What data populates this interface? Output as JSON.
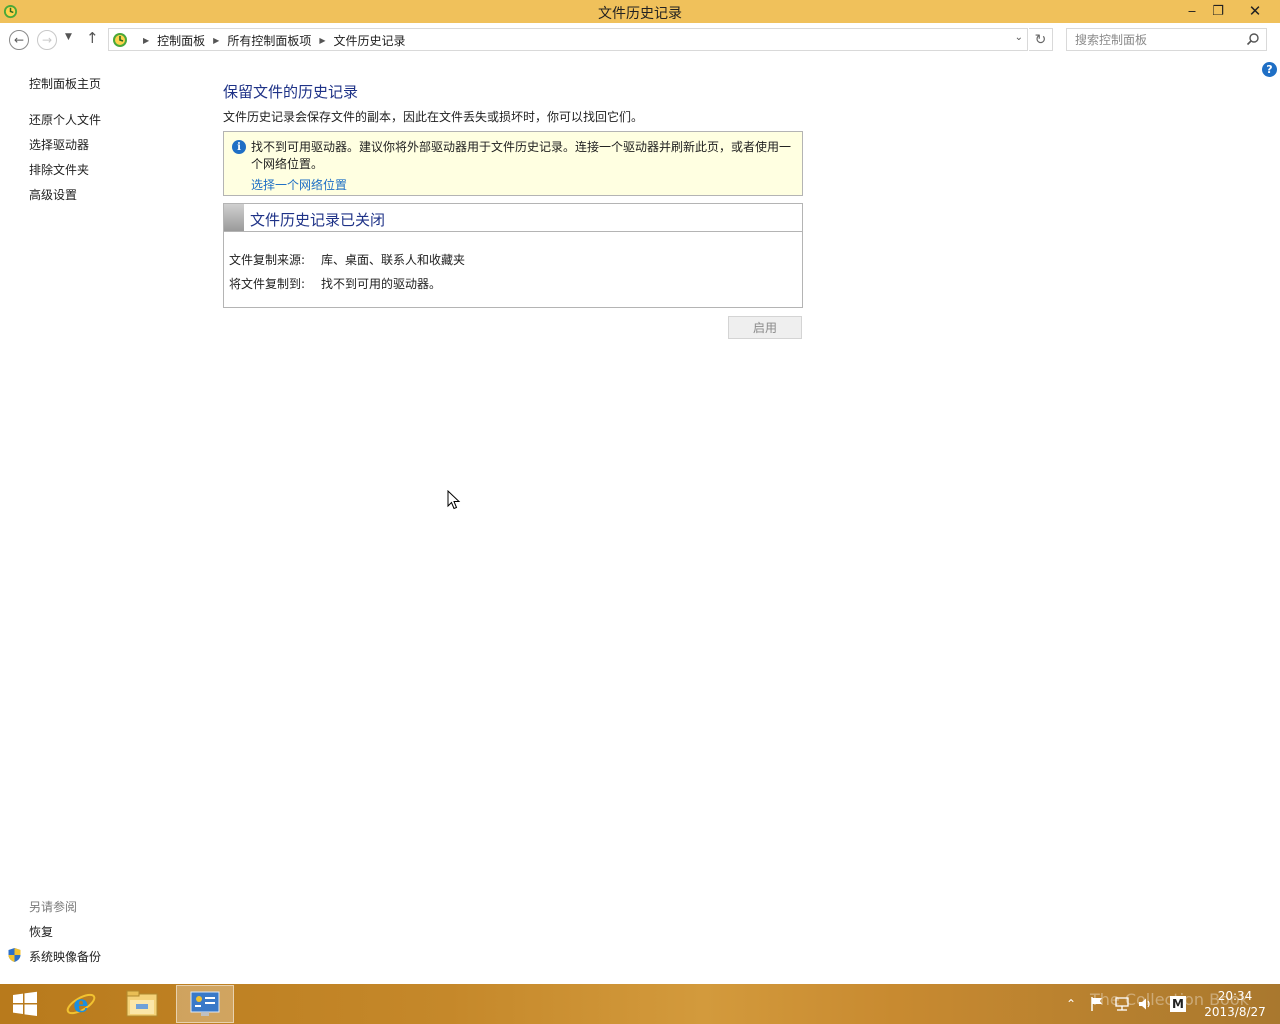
{
  "window": {
    "title": "文件历史记录",
    "minimize_label": "‒",
    "maximize_label": "❐",
    "close_label": "✕"
  },
  "address_bar": {
    "breadcrumbs": [
      "控制面板",
      "所有控制面板项",
      "文件历史记录"
    ],
    "search_placeholder": "搜索控制面板"
  },
  "help_label": "?",
  "left_nav": {
    "home": "控制面板主页",
    "items": [
      "还原个人文件",
      "选择驱动器",
      "排除文件夹",
      "高级设置"
    ],
    "see_also_title": "另请参阅",
    "see_also": [
      "恢复",
      "系统映像备份"
    ]
  },
  "main": {
    "heading": "保留文件的历史记录",
    "description": "文件历史记录会保存文件的副本，因此在文件丢失或损坏时，你可以找回它们。",
    "info": {
      "message": "找不到可用驱动器。建议你将外部驱动器用于文件历史记录。连接一个驱动器并刷新此页，或者使用一个网络位置。",
      "link": "选择一个网络位置"
    },
    "status": {
      "title": "文件历史记录已关闭",
      "source_label": "文件复制来源:",
      "source_value": "库、桌面、联系人和收藏夹",
      "target_label": "将文件复制到:",
      "target_value": "找不到可用的驱动器。"
    },
    "enable_button": "启用"
  },
  "taskbar": {
    "time": "20:34",
    "date": "2013/8/27",
    "watermark": "The Collection Book",
    "ime_label": "M"
  },
  "colors": {
    "titlebar": "#f0c15b",
    "heading": "#1e3287",
    "link": "#1e6fc5",
    "info_background": "#ffffe1"
  }
}
